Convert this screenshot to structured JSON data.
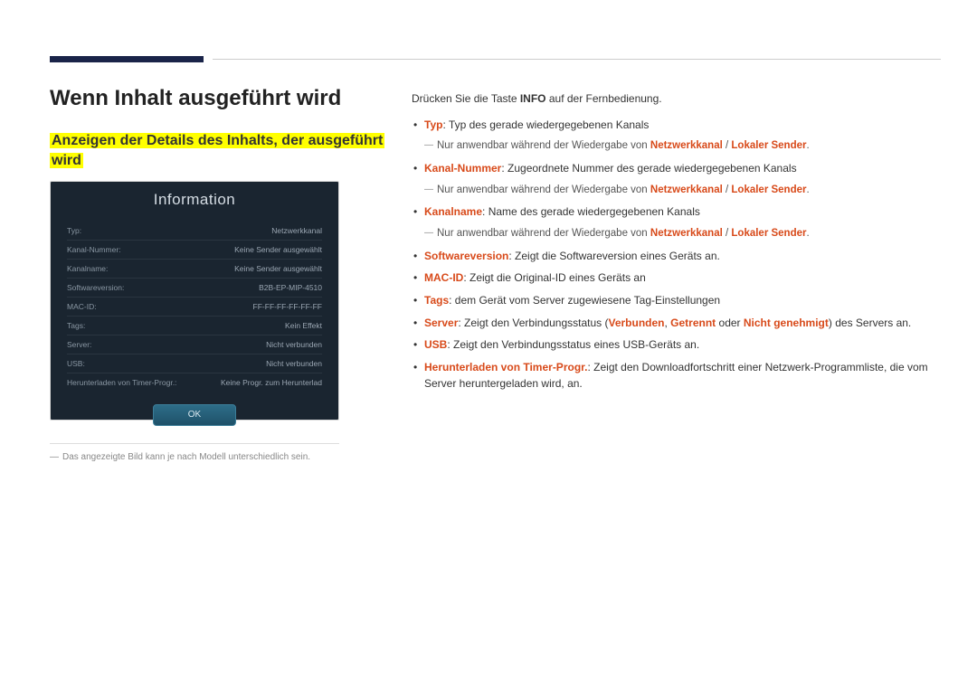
{
  "heading": "Wenn Inhalt ausgeführt wird",
  "subheading_line1": "Anzeigen der Details des Inhalts, der ausgeführt",
  "subheading_line2": "wird",
  "panel": {
    "title": "Information",
    "rows": [
      {
        "label": "Typ:",
        "value": "Netzwerkkanal"
      },
      {
        "label": "Kanal-Nummer:",
        "value": "Keine Sender ausgewählt"
      },
      {
        "label": "Kanalname:",
        "value": "Keine Sender ausgewählt"
      },
      {
        "label": "Softwareversion:",
        "value": "B2B-EP-MIP-4510"
      },
      {
        "label": "MAC-ID:",
        "value": "FF-FF-FF-FF-FF-FF"
      },
      {
        "label": "Tags:",
        "value": "Kein Effekt"
      },
      {
        "label": "Server:",
        "value": "Nicht verbunden"
      },
      {
        "label": "USB:",
        "value": "Nicht verbunden"
      },
      {
        "label": "Herunterladen von Timer-Progr.:",
        "value": "Keine Progr. zum Herunterlad"
      }
    ],
    "ok": "OK"
  },
  "footnote_dash": "―",
  "footnote": "Das angezeigte Bild kann je nach Modell unterschiedlich sein.",
  "right": {
    "intro_pre": "Drücken Sie die Taste ",
    "intro_bold": "INFO",
    "intro_post": " auf der Fernbedienung.",
    "items": [
      {
        "term": "Typ",
        "rest": ": Typ des gerade wiedergegebenen Kanals",
        "sub_pre": "Nur anwendbar während der Wiedergabe von ",
        "sub_t1": "Netzwerkkanal",
        "sub_sep": " / ",
        "sub_t2": "Lokaler Sender",
        "sub_post": "."
      },
      {
        "term": "Kanal-Nummer",
        "rest": ": Zugeordnete Nummer des gerade wiedergegebenen Kanals",
        "sub_pre": "Nur anwendbar während der Wiedergabe von ",
        "sub_t1": "Netzwerkkanal",
        "sub_sep": " / ",
        "sub_t2": "Lokaler Sender",
        "sub_post": "."
      },
      {
        "term": "Kanalname",
        "rest": ": Name des gerade wiedergegebenen Kanals",
        "sub_pre": "Nur anwendbar während der Wiedergabe von ",
        "sub_t1": "Netzwerkkanal",
        "sub_sep": " / ",
        "sub_t2": "Lokaler Sender",
        "sub_post": "."
      },
      {
        "term": "Softwareversion",
        "rest": ": Zeigt die Softwareversion eines Geräts an."
      },
      {
        "term": "MAC-ID",
        "rest": ": Zeigt die Original-ID eines Geräts an"
      },
      {
        "term": "Tags",
        "rest": ": dem Gerät vom Server zugewiesene Tag-Einstellungen"
      },
      {
        "term": "Server",
        "rest_pre": ": Zeigt den Verbindungsstatus (",
        "st1": "Verbunden",
        "sep1": ", ",
        "st2": "Getrennt",
        "sep2": " oder ",
        "st3": "Nicht genehmigt",
        "rest_post": ") des Servers an."
      },
      {
        "term": "USB",
        "rest": ": Zeigt den Verbindungsstatus eines USB-Geräts an."
      },
      {
        "term": "Herunterladen von Timer-Progr.",
        "rest": ": Zeigt den Downloadfortschritt einer Netzwerk-Programmliste, die vom Server heruntergeladen wird, an."
      }
    ]
  }
}
